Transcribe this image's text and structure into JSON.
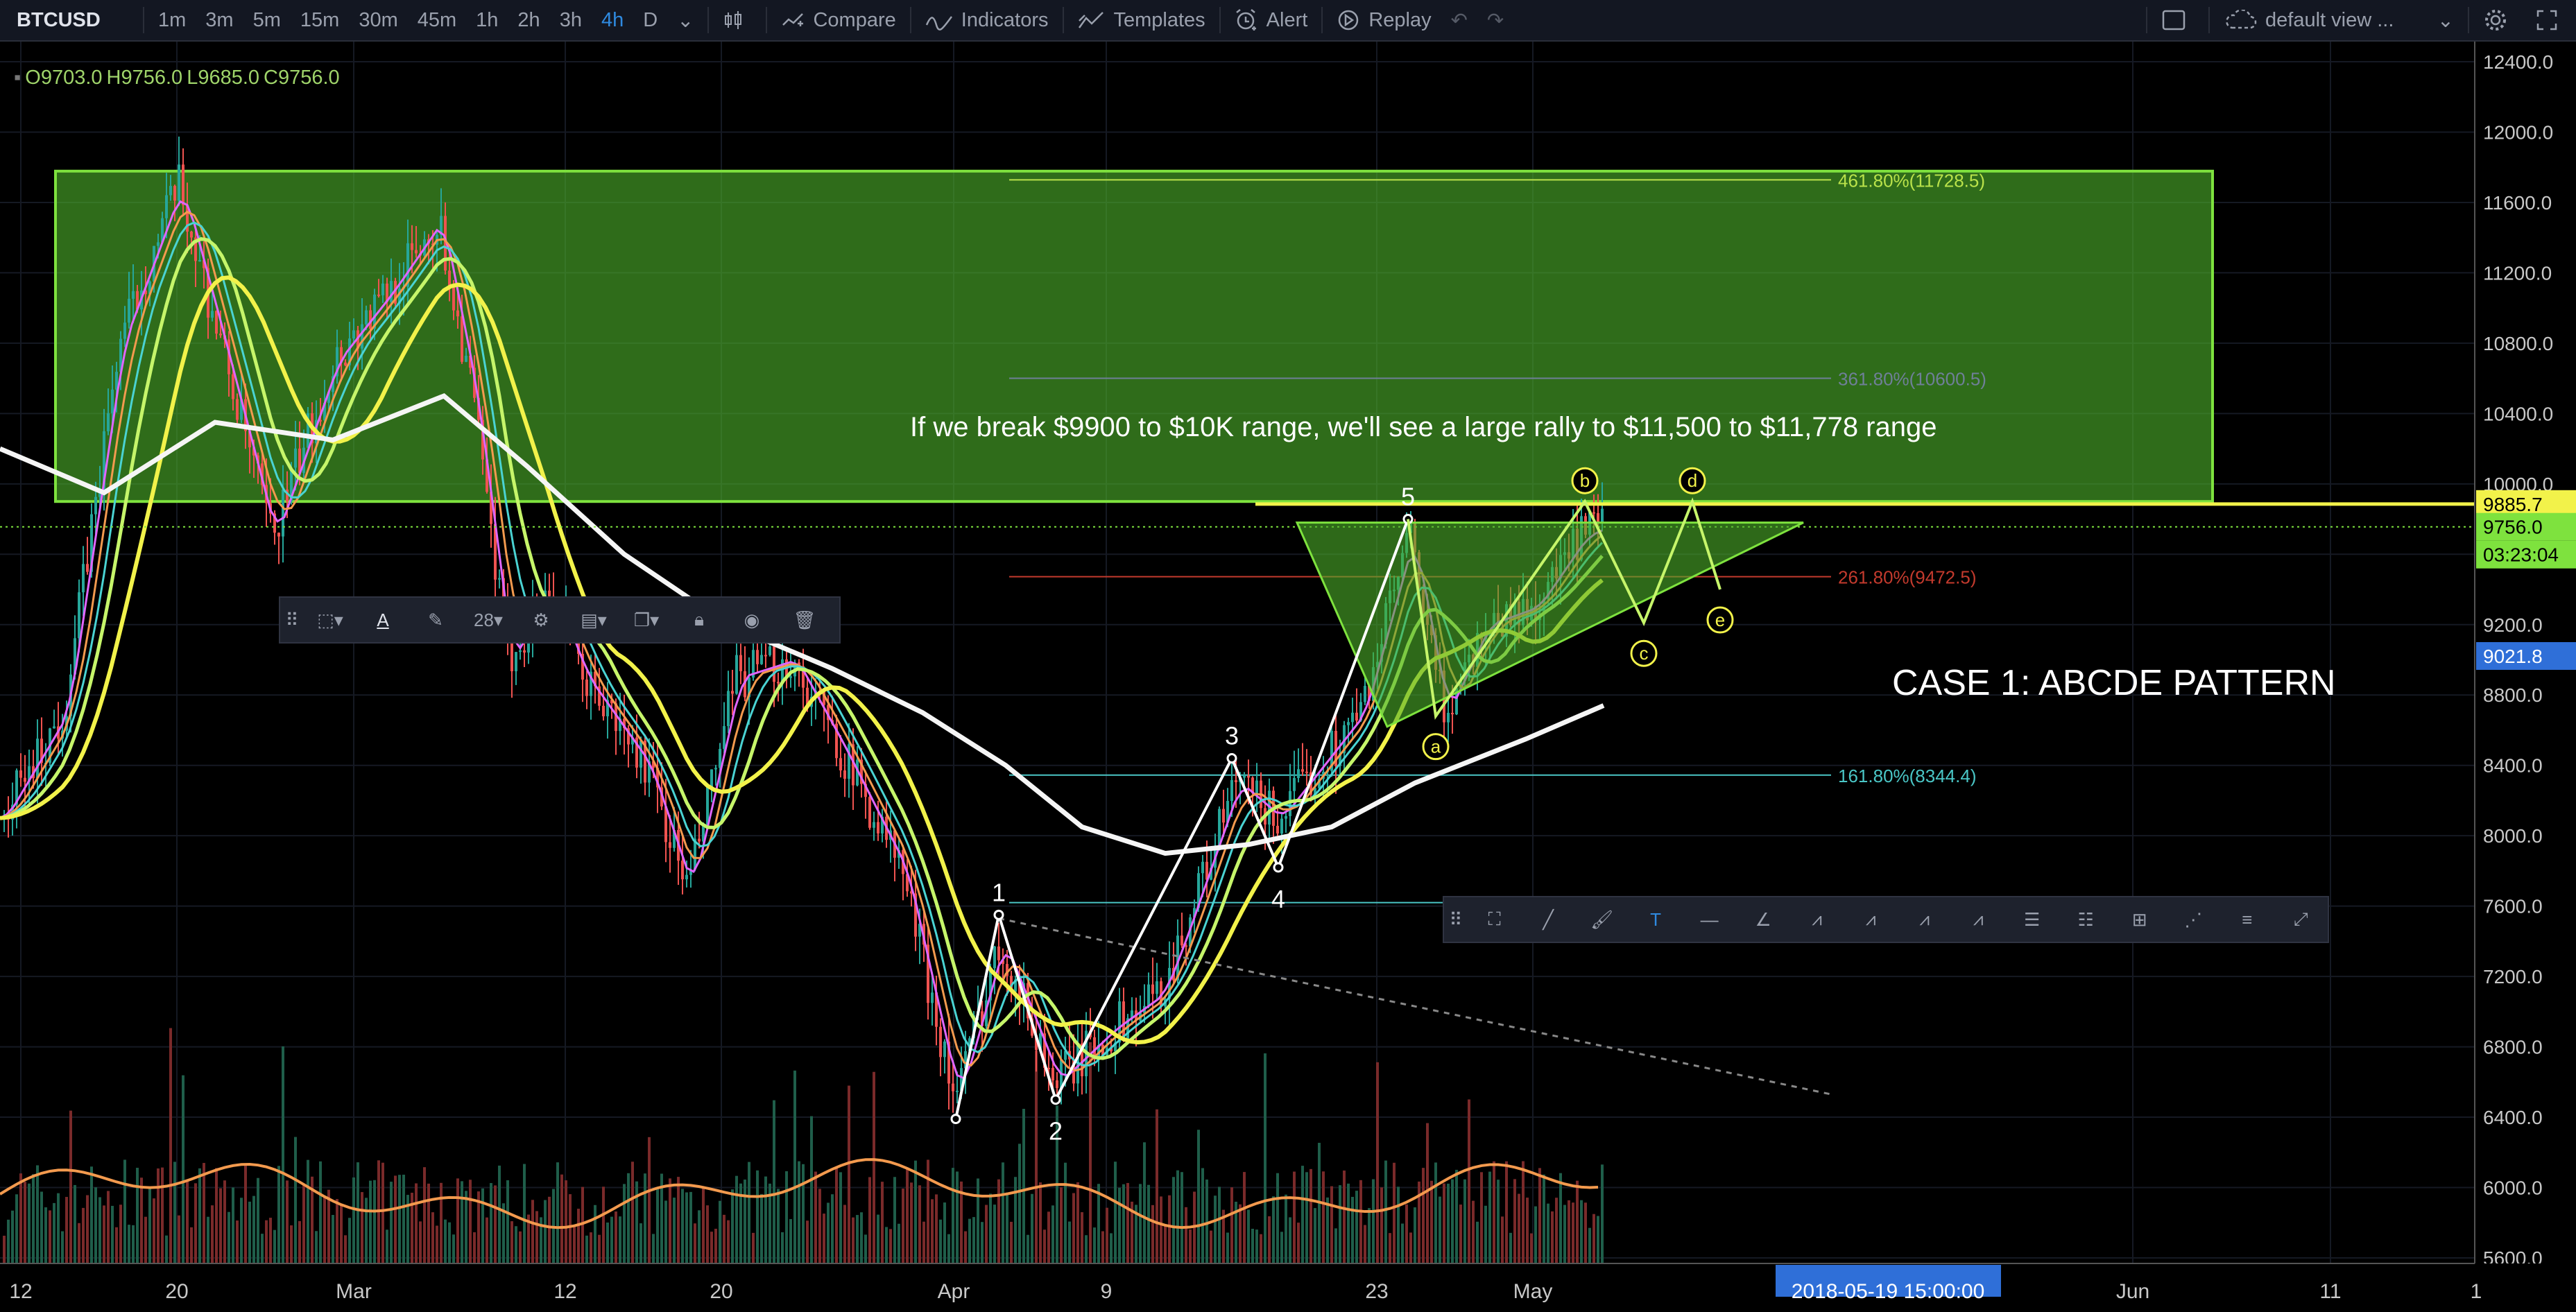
{
  "toolbar": {
    "symbol": "BTCUSD",
    "intervals": [
      "1m",
      "3m",
      "5m",
      "15m",
      "30m",
      "45m",
      "1h",
      "2h",
      "3h",
      "4h",
      "D"
    ],
    "active_interval": "4h",
    "compare_label": "Compare",
    "indicators_label": "Indicators",
    "templates_label": "Templates",
    "alert_label": "Alert",
    "replay_label": "Replay",
    "layout_label": "default view ..."
  },
  "ohlc": {
    "o": "O9703.0",
    "h": "H9756.0",
    "l": "L9685.0",
    "c": "C9756.0"
  },
  "annotations": {
    "rally_text": "If we break $9900 to $10K range, we'll see a large rally to $11,500 to $11,778 range",
    "case_text": "CASE 1: ABCDE PATTERN",
    "wave_labels": [
      "1",
      "2",
      "3",
      "4",
      "5"
    ],
    "abcde_labels": [
      "a",
      "b",
      "c",
      "d",
      "e"
    ],
    "fib_levels": [
      "461.80%(11728.5)",
      "361.80%(10600.5)",
      "261.80%(9472.5)",
      "161.80%(8344.4)"
    ]
  },
  "price_badges": {
    "level": "9885.7",
    "last": "9756.0",
    "countdown": "03:23:04",
    "cross": "9021.8"
  },
  "date_badge": "2018-05-19 15:00:00",
  "drawing_toolbar": {
    "font_size": "28"
  },
  "colors": {
    "bg": "#000000",
    "zone": "#4caf2a",
    "bull": "#26a69a",
    "bear": "#ef5350",
    "ma_white": "#f5f5f5",
    "ma_yellow": "#f2f24a",
    "ma_lime": "#c6f56a",
    "vol_ma": "#f39a4e",
    "fib": "#d4d84a"
  },
  "chart_data": {
    "type": "candlestick",
    "y_ticks": [
      12400,
      12000,
      11600,
      11200,
      10800,
      10400,
      10000,
      9600,
      9200,
      8800,
      8400,
      8000,
      7600,
      7200,
      6800,
      6400,
      6000,
      5600
    ],
    "ylim": [
      5560,
      12460
    ],
    "x_ticks": [
      "12",
      "20",
      "Mar",
      "12",
      "20",
      "Apr",
      "9",
      "23",
      "May",
      "Jun",
      "11",
      "1"
    ],
    "x_ticks_hidden_under_badge": "",
    "annotated_levels": {
      "resistance": 9885.7,
      "last": 9756.0,
      "cross": 9021.8
    },
    "zone": {
      "from": 9900,
      "to": 11778
    },
    "fib": [
      {
        "label": "461.80%",
        "value": 11728.5
      },
      {
        "label": "361.80%",
        "value": 10600.5
      },
      {
        "label": "261.80%",
        "value": 9472.5
      },
      {
        "label": "161.80%",
        "value": 8344.4
      }
    ],
    "elliott_waves": [
      {
        "label": "1",
        "price": 7550
      },
      {
        "label": "2",
        "price": 6500
      },
      {
        "label": "3",
        "price": 8440
      },
      {
        "label": "4",
        "price": 7820
      },
      {
        "label": "5",
        "price": 9800
      }
    ],
    "abcde": [
      {
        "label": "a",
        "price": 8680
      },
      {
        "label": "b",
        "price": 9900
      },
      {
        "label": "c",
        "price": 9210
      },
      {
        "label": "d",
        "price": 9900
      },
      {
        "label": "e",
        "price": 9400
      }
    ]
  }
}
